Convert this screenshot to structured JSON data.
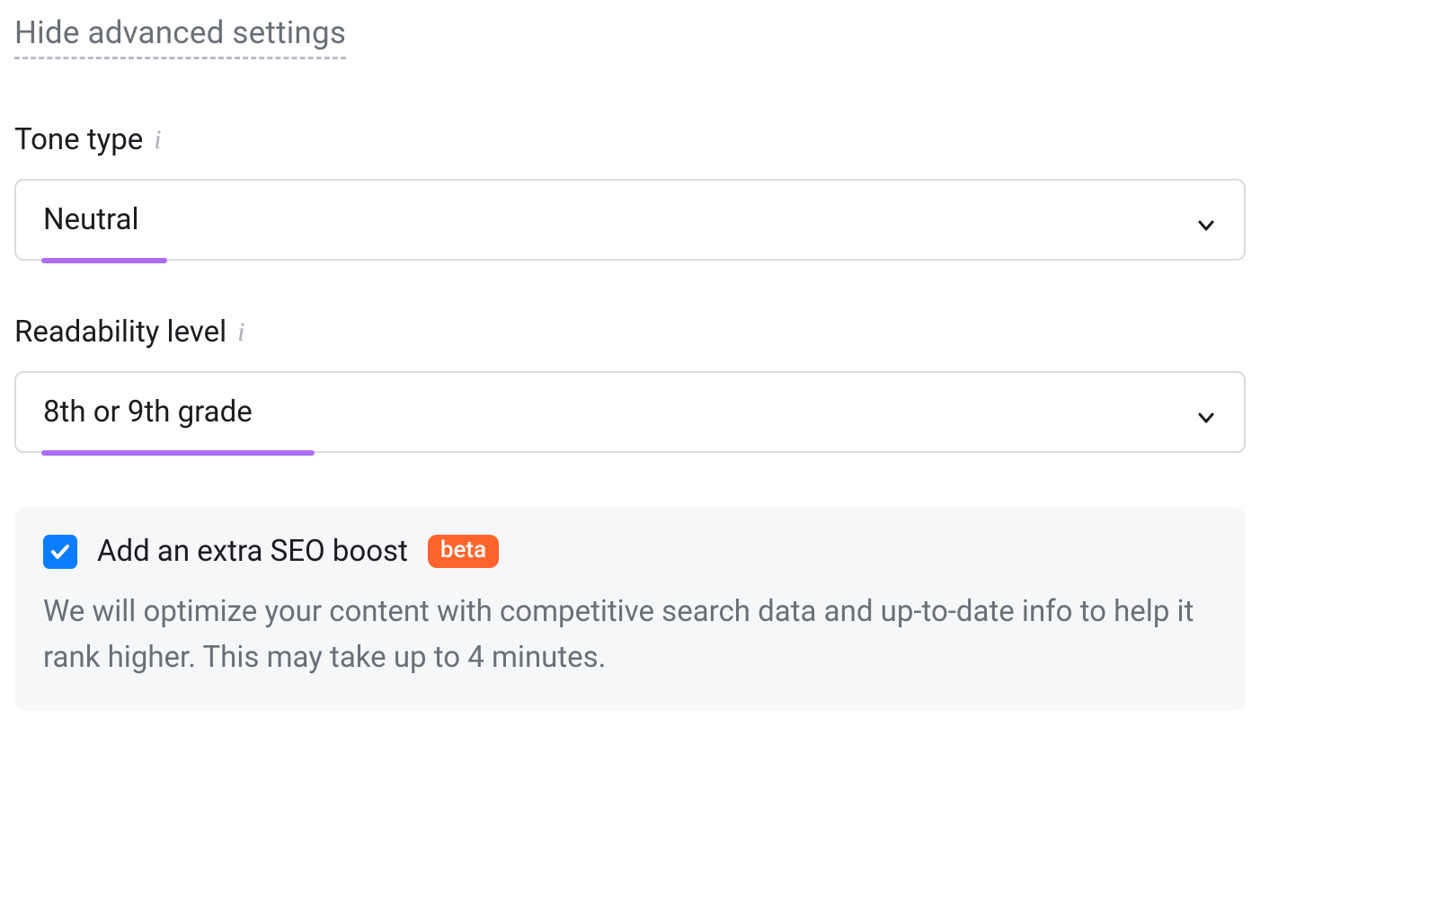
{
  "toggle_label": "Hide advanced settings",
  "tone": {
    "label": "Tone type",
    "value": "Neutral"
  },
  "readability": {
    "label": "Readability level",
    "value": "8th or 9th grade"
  },
  "boost": {
    "checked": true,
    "title": "Add an extra SEO boost",
    "badge": "beta",
    "description": "We will optimize your content with competitive search data and up-to-date info to help it rank higher. This may take up to 4 minutes."
  }
}
